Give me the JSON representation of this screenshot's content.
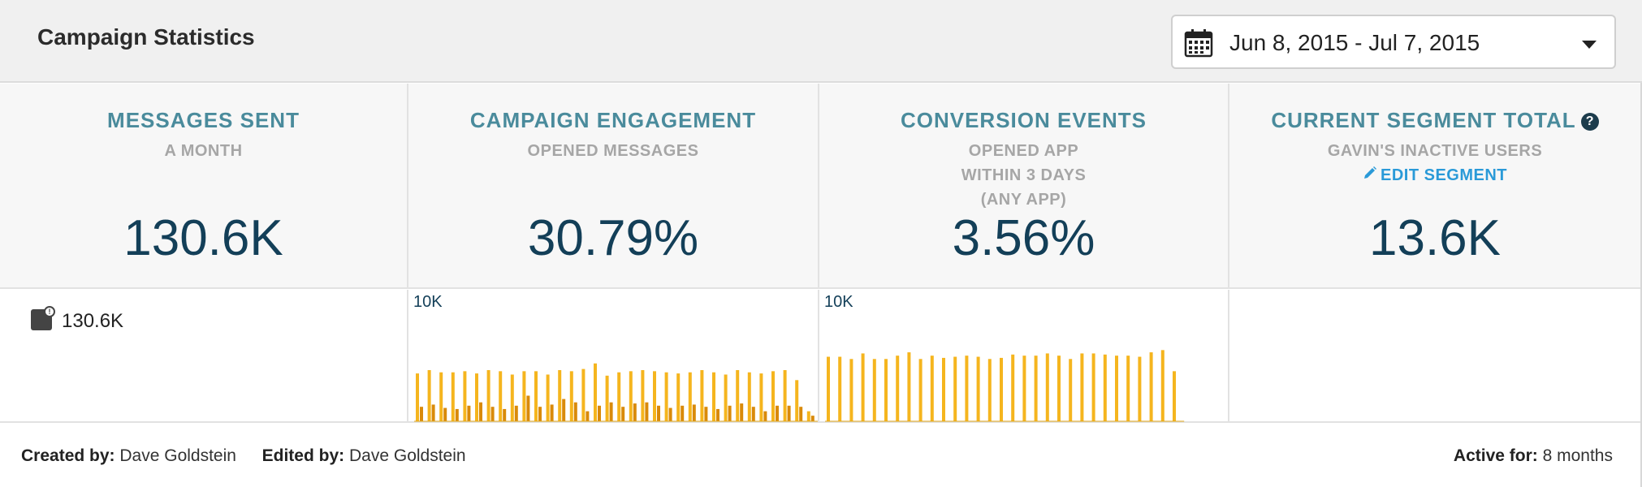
{
  "header": {
    "title": "Campaign Statistics",
    "date_range": "Jun 8, 2015 - Jul 7, 2015",
    "calendar_icon": "calendar-icon",
    "dropdown_icon": "chevron-down-icon"
  },
  "stats": [
    {
      "title": "MESSAGES SENT",
      "sub": [
        "A MONTH"
      ],
      "value": "130.6K"
    },
    {
      "title": "CAMPAIGN ENGAGEMENT",
      "sub": [
        "OPENED MESSAGES"
      ],
      "value": "30.79%"
    },
    {
      "title": "CONVERSION EVENTS",
      "sub": [
        "OPENED APP",
        "WITHIN 3 DAYS",
        "(ANY APP)"
      ],
      "value": "3.56%"
    },
    {
      "title": "CURRENT SEGMENT TOTAL",
      "help": "?",
      "sub": [
        "GAVIN'S INACTIVE USERS"
      ],
      "edit_label": "EDIT SEGMENT",
      "value": "13.6K"
    }
  ],
  "sent_summary": {
    "icon": "message-icon",
    "value": "130.6K"
  },
  "chart_data": [
    {
      "type": "bar",
      "y_tick_label": "10K",
      "ylim": [
        0,
        10000
      ],
      "series": [
        {
          "values": [
            4300,
            4600,
            4400,
            4400,
            4500,
            4300,
            4600,
            4500,
            4200,
            4500,
            4500,
            4200,
            4600,
            4500,
            4700,
            5200,
            4100,
            4400,
            4500,
            4600,
            4500,
            4400,
            4300,
            4400,
            4600,
            4400,
            4200,
            4600,
            4400,
            4300,
            4500,
            4600,
            3700,
            900
          ]
        },
        {
          "values": [
            1300,
            1500,
            1200,
            1100,
            1400,
            1700,
            1300,
            1100,
            1400,
            2300,
            1300,
            1500,
            2000,
            1700,
            900,
            1400,
            1700,
            1300,
            1600,
            1700,
            1400,
            1200,
            1400,
            1500,
            1300,
            1100,
            1400,
            1600,
            1300,
            900,
            1400,
            1400,
            1300,
            500
          ]
        }
      ],
      "colors": [
        "#f5b51e",
        "#d98a0a"
      ]
    },
    {
      "type": "bar",
      "y_tick_label": "10K",
      "ylim": [
        0,
        10000
      ],
      "series": [
        {
          "values": [
            5800,
            5800,
            5600,
            6100,
            5600,
            5600,
            5900,
            6200,
            5600,
            5900,
            5700,
            5800,
            5900,
            5800,
            5600,
            5700,
            6000,
            5900,
            5900,
            6100,
            5900,
            5600,
            6100,
            6100,
            6000,
            5900,
            5900,
            5800,
            6200,
            6400,
            4500
          ]
        }
      ],
      "colors": [
        "#f5b51e"
      ]
    }
  ],
  "footer": {
    "created_label": "Created by:",
    "created_value": "Dave Goldstein",
    "edited_label": "Edited by:",
    "edited_value": "Dave Goldstein",
    "active_label": "Active for:",
    "active_value": "8 months"
  }
}
